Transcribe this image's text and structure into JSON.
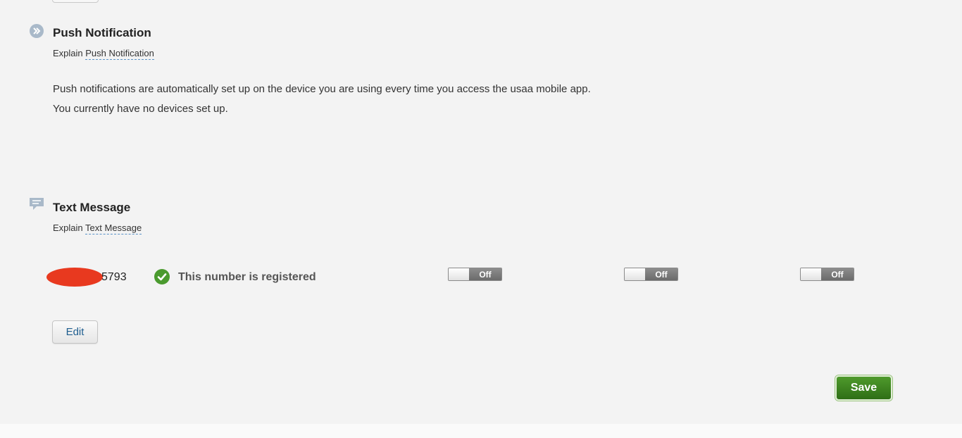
{
  "push": {
    "title": "Push Notification",
    "explain_prefix": "Explain",
    "explain_link": "Push Notification",
    "line1": "Push notifications are automatically set up on the device you are using every time you access the usaa mobile app.",
    "line2": "You currently have no devices set up.",
    "icon": "arrow-circle-icon"
  },
  "text": {
    "title": "Text Message",
    "explain_prefix": "Explain",
    "explain_link": "Text Message",
    "icon": "speech-bubble-icon",
    "phone_suffix": "5793",
    "status": "This number is registered",
    "toggles": [
      "Off",
      "Off",
      "Off"
    ],
    "edit_label": "Edit"
  },
  "save_label": "Save",
  "colors": {
    "save_green": "#3f8522",
    "redaction": "#e8391f",
    "check_green": "#4a9a2e",
    "link_blue": "#1f5e8f"
  }
}
